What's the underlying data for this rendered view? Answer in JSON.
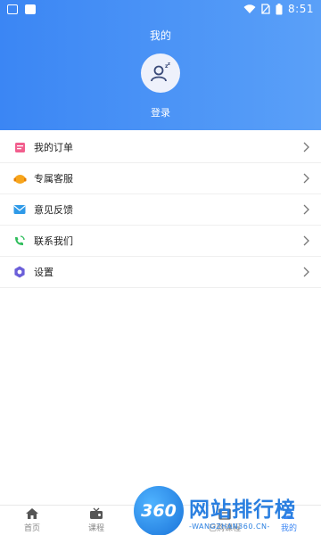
{
  "status": {
    "time": "8:51"
  },
  "header": {
    "title": "我的",
    "login": "登录"
  },
  "menu": [
    {
      "label": "我的订单",
      "icon": "orders-icon"
    },
    {
      "label": "专属客服",
      "icon": "customer-service-icon"
    },
    {
      "label": "意见反馈",
      "icon": "feedback-icon"
    },
    {
      "label": "联系我们",
      "icon": "contact-phone-icon"
    },
    {
      "label": "设置",
      "icon": "settings-icon"
    }
  ],
  "tabs": [
    {
      "label": "首页",
      "icon": "home-icon"
    },
    {
      "label": "课程",
      "icon": "course-icon"
    },
    {
      "label": "",
      "icon": "study-icon"
    },
    {
      "label": "已购课程",
      "icon": "purchased-icon"
    },
    {
      "label": "我的",
      "icon": "profile-icon",
      "active": true
    }
  ],
  "watermark": {
    "logo": "360",
    "main": "网站排行榜",
    "sub": "-WANGZHAN360.CN-"
  },
  "colors": {
    "accent": "#3b86f4",
    "header_start": "#3b86f4",
    "header_end": "#5aa0f8"
  }
}
